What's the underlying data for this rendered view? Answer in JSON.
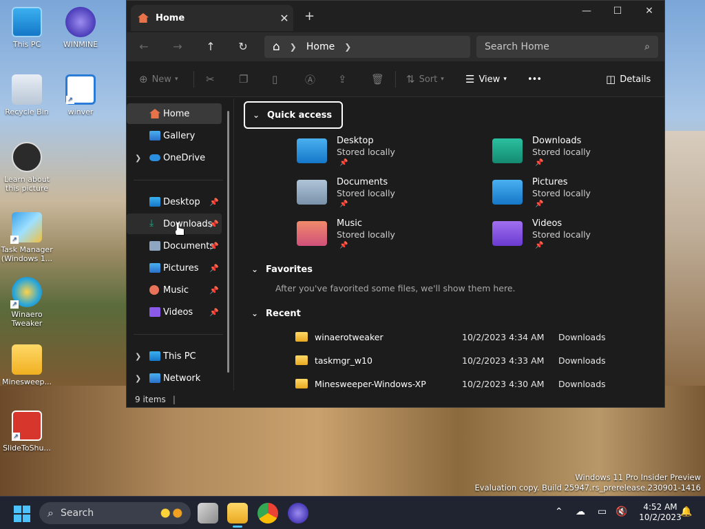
{
  "desktop": {
    "icons": [
      {
        "label": "This PC",
        "icon": "pc-icon"
      },
      {
        "label": "WINMINE",
        "icon": "mine-icon"
      },
      {
        "label": "Recycle Bin",
        "icon": "recycle-bin-icon"
      },
      {
        "label": "winver",
        "icon": "winver-icon"
      },
      {
        "label": "Learn about this picture",
        "icon": "learn-icon"
      },
      {
        "label": "Task Manager (Windows 1...",
        "icon": "task-manager-icon"
      },
      {
        "label": "Winaero Tweaker",
        "icon": "winaero-icon"
      },
      {
        "label": "Minesweep...",
        "icon": "folder-icon"
      },
      {
        "label": "SlideToShu...",
        "icon": "slide-to-shutdown-icon"
      }
    ],
    "watermark": {
      "line1": "Windows 11 Pro Insider Preview",
      "line2": "Evaluation copy. Build 25947.rs_prerelease.230901-1416"
    }
  },
  "explorer": {
    "tab_title": "Home",
    "new_tab": "+",
    "window_controls": {
      "minimize": "—",
      "maximize": "☐",
      "close": "✕"
    },
    "address": {
      "home_icon": "⌂",
      "path": "Home"
    },
    "search": {
      "placeholder": "Search Home"
    },
    "toolbar": {
      "new_label": "New",
      "sort_label": "Sort",
      "view_label": "View",
      "more_label": "•••",
      "details_label": "Details"
    },
    "sidebar": {
      "top": [
        {
          "label": "Home",
          "icon": "home-icon",
          "selected": true
        },
        {
          "label": "Gallery",
          "icon": "gallery-icon"
        },
        {
          "label": "OneDrive",
          "icon": "onedrive-icon",
          "expandable": true
        }
      ],
      "pinned": [
        {
          "label": "Desktop",
          "icon": "desktop-icon"
        },
        {
          "label": "Downloads",
          "icon": "downloads-icon",
          "hover": true
        },
        {
          "label": "Documents",
          "icon": "documents-icon"
        },
        {
          "label": "Pictures",
          "icon": "pictures-icon"
        },
        {
          "label": "Music",
          "icon": "music-icon"
        },
        {
          "label": "Videos",
          "icon": "videos-icon"
        }
      ],
      "bottom": [
        {
          "label": "This PC",
          "icon": "pc-icon"
        },
        {
          "label": "Network",
          "icon": "network-icon"
        }
      ]
    },
    "quick_access": {
      "header": "Quick access",
      "items": [
        {
          "name": "Desktop",
          "sub": "Stored locally",
          "color": "#2a8fe0"
        },
        {
          "name": "Downloads",
          "sub": "Stored locally",
          "color": "#1aaa8a"
        },
        {
          "name": "Documents",
          "sub": "Stored locally",
          "color": "#8ea6bf"
        },
        {
          "name": "Pictures",
          "sub": "Stored locally",
          "color": "#2a8fe0"
        },
        {
          "name": "Music",
          "sub": "Stored locally",
          "color": "#e8735a"
        },
        {
          "name": "Videos",
          "sub": "Stored locally",
          "color": "#8a5ae8"
        }
      ]
    },
    "favorites": {
      "header": "Favorites",
      "message": "After you've favorited some files, we'll show them here."
    },
    "recent": {
      "header": "Recent",
      "rows": [
        {
          "name": "winaerotweaker",
          "date": "10/2/2023 4:34 AM",
          "location": "Downloads"
        },
        {
          "name": "taskmgr_w10",
          "date": "10/2/2023 4:33 AM",
          "location": "Downloads"
        },
        {
          "name": "Minesweeper-Windows-XP",
          "date": "10/2/2023 4:30 AM",
          "location": "Downloads"
        }
      ]
    },
    "status": "9 items"
  },
  "taskbar": {
    "search_label": "Search",
    "clock_time": "4:52 AM",
    "clock_date": "10/2/2023"
  }
}
